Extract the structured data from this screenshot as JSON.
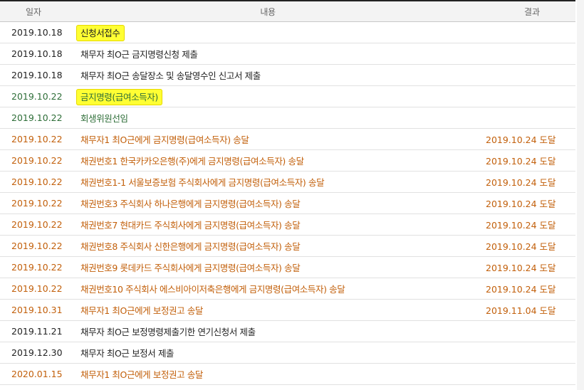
{
  "colors": {
    "black": "#222222",
    "green": "#2e6e38",
    "orange": "#c25f0a",
    "highlight": "#ffff33"
  },
  "header": {
    "date": "일자",
    "content": "내용",
    "result": "결과"
  },
  "rows": [
    {
      "date": "2019.10.18",
      "content": "신청서접수",
      "result": "",
      "color": "#222222",
      "highlight": true
    },
    {
      "date": "2019.10.18",
      "content": "채무자 최O근 금지명령신청 제출",
      "result": "",
      "color": "#222222",
      "highlight": false
    },
    {
      "date": "2019.10.18",
      "content": "채무자 최O근 송달장소 및 송달영수인 신고서 제출",
      "result": "",
      "color": "#222222",
      "highlight": false
    },
    {
      "date": "2019.10.22",
      "content": "금지명령(급여소득자)",
      "result": "",
      "color": "#2e6e38",
      "highlight": true
    },
    {
      "date": "2019.10.22",
      "content": "회생위원선임",
      "result": "",
      "color": "#2e6e38",
      "highlight": false
    },
    {
      "date": "2019.10.22",
      "content": "채무자1 최O근에게 금지명령(급여소득자) 송달",
      "result": "2019.10.24 도달",
      "color": "#c25f0a",
      "highlight": false
    },
    {
      "date": "2019.10.22",
      "content": "채권번호1 한국카카오은행(주)에게 금지명령(급여소득자) 송달",
      "result": "2019.10.24 도달",
      "color": "#c25f0a",
      "highlight": false
    },
    {
      "date": "2019.10.22",
      "content": "채권번호1-1 서울보증보험 주식회사에게 금지명령(급여소득자) 송달",
      "result": "2019.10.24 도달",
      "color": "#c25f0a",
      "highlight": false
    },
    {
      "date": "2019.10.22",
      "content": "채권번호3 주식회사 하나은행에게 금지명령(급여소득자) 송달",
      "result": "2019.10.24 도달",
      "color": "#c25f0a",
      "highlight": false
    },
    {
      "date": "2019.10.22",
      "content": "채권번호7 현대카드 주식회사에게 금지명령(급여소득자) 송달",
      "result": "2019.10.24 도달",
      "color": "#c25f0a",
      "highlight": false
    },
    {
      "date": "2019.10.22",
      "content": "채권번호8 주식회사 신한은행에게 금지명령(급여소득자) 송달",
      "result": "2019.10.24 도달",
      "color": "#c25f0a",
      "highlight": false
    },
    {
      "date": "2019.10.22",
      "content": "채권번호9 롯데카드 주식회사에게 금지명령(급여소득자) 송달",
      "result": "2019.10.24 도달",
      "color": "#c25f0a",
      "highlight": false
    },
    {
      "date": "2019.10.22",
      "content": "채권번호10 주식회사 에스비아이저축은행에게 금지명령(급여소득자) 송달",
      "result": "2019.10.24 도달",
      "color": "#c25f0a",
      "highlight": false
    },
    {
      "date": "2019.10.31",
      "content": "채무자1 최O근에게 보정권고 송달",
      "result": "2019.11.04 도달",
      "color": "#c25f0a",
      "highlight": false
    },
    {
      "date": "2019.11.21",
      "content": "채무자 최O근 보정명령제출기한 연기신청서 제출",
      "result": "",
      "color": "#222222",
      "highlight": false
    },
    {
      "date": "2019.12.30",
      "content": "채무자 최O근 보정서 제출",
      "result": "",
      "color": "#222222",
      "highlight": false
    },
    {
      "date": "2020.01.15",
      "content": "채무자1 최O근에게 보정권고 송달",
      "result": "",
      "color": "#c25f0a",
      "highlight": false
    }
  ]
}
